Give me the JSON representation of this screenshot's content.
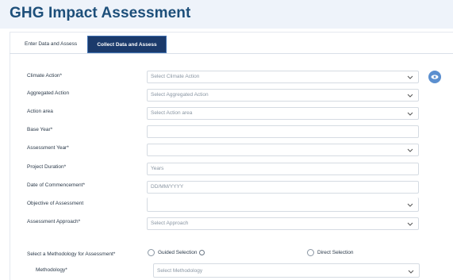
{
  "page": {
    "title": "GHG Impact Assessment"
  },
  "tabs": [
    {
      "label": "Enter Data and Assess",
      "active": false
    },
    {
      "label": "Collect Data and Assess",
      "active": true
    }
  ],
  "form": {
    "climate_action": {
      "label": "Climate Action*",
      "placeholder": "Select Climate Action"
    },
    "aggregated_action": {
      "label": "Aggregated Action",
      "placeholder": "Select Aggregated Action"
    },
    "action_area": {
      "label": "Action area",
      "placeholder": "Select Action area"
    },
    "base_year": {
      "label": "Base Year*",
      "value": ""
    },
    "assessment_year": {
      "label": "Assessment Year*",
      "value": ""
    },
    "project_duration": {
      "label": "Project Duration*",
      "placeholder": "Years"
    },
    "date_of_commencement": {
      "label": "Date of Commencement*",
      "placeholder": "DD/MM/YYYY"
    },
    "objective": {
      "label": "Objective of Assessment",
      "value": ""
    },
    "assessment_approach": {
      "label": "Assessment Approach*",
      "placeholder": "Select Approach"
    },
    "methodology_selection": {
      "label": "Select a Methodology for Assessment*",
      "options": [
        "Guided Selection",
        "Direct Selection"
      ]
    },
    "methodology": {
      "label": "Methodology*",
      "placeholder": "Select Methodology"
    }
  },
  "colors": {
    "accent": "#1b3a6b",
    "title": "#1d4f7a",
    "eye_button": "#5b8fcf"
  },
  "icons": {
    "eye": "eye-icon",
    "dropdown": "chevron-down-icon",
    "info": "info-icon"
  }
}
